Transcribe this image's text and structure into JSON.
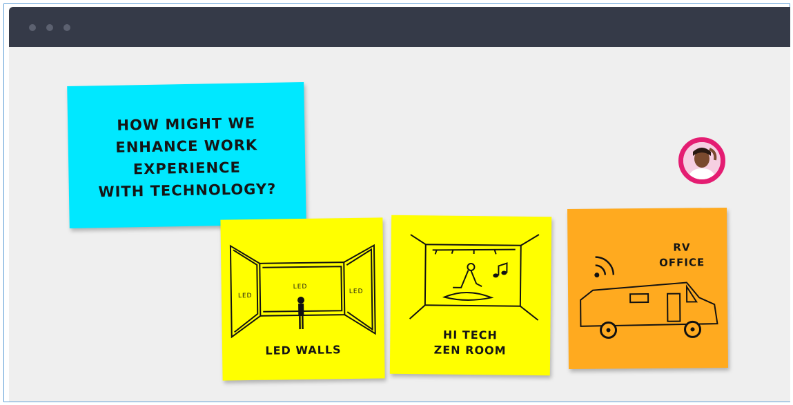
{
  "window": {
    "controls": [
      "dot",
      "dot",
      "dot"
    ]
  },
  "notes": {
    "question": {
      "lines": [
        "HOW MIGHT WE",
        "ENHANCE WORK",
        "EXPERIENCE",
        "WITH TECHNOLOGY?"
      ],
      "color": "#00e8ff"
    },
    "led_walls": {
      "title": "LED WALLS",
      "labels": [
        "LED",
        "LED",
        "LED"
      ],
      "color": "#ffff00"
    },
    "zen_room": {
      "title_line1": "HI TECH",
      "title_line2": "ZEN ROOM",
      "color": "#ffff00"
    },
    "rv_office": {
      "title_line1": "RV",
      "title_line2": "OFFICE",
      "color": "#ffaa1f"
    }
  },
  "avatar": {
    "ring_color": "#e41d72"
  }
}
